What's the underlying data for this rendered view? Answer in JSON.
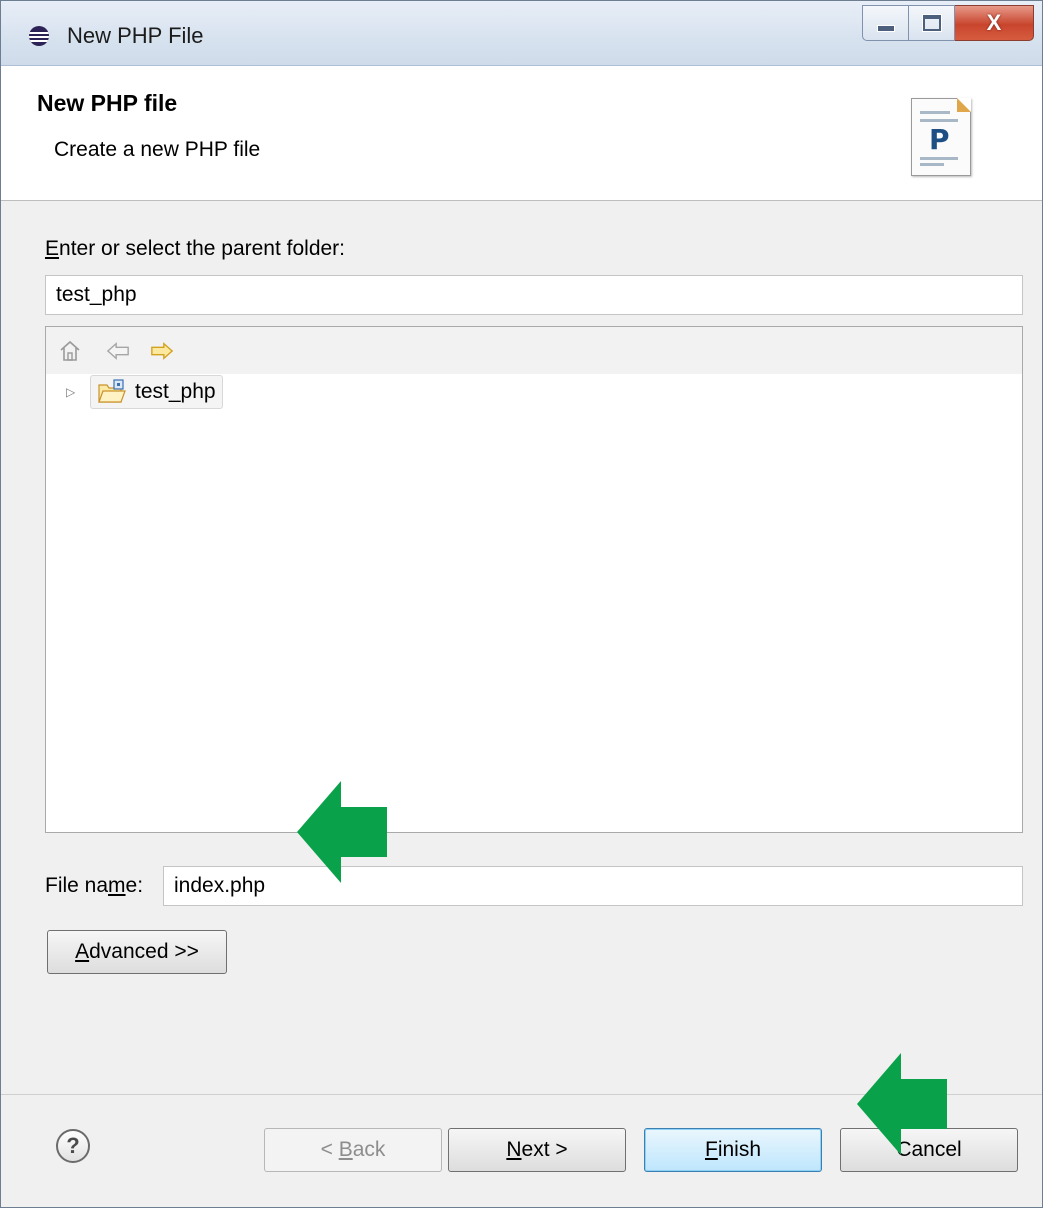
{
  "window": {
    "title": "New PHP File"
  },
  "header": {
    "title": "New PHP file",
    "description": "Create a new PHP file"
  },
  "parent_folder": {
    "label_mnemonic": "E",
    "label_rest": "nter or select the parent folder:",
    "value": "test_php"
  },
  "tree": {
    "items": [
      {
        "label": "test_php",
        "expanded": false
      }
    ]
  },
  "file_name": {
    "label_pre": "File na",
    "label_mnemonic": "m",
    "label_post": "e:",
    "value": "index.php"
  },
  "buttons": {
    "advanced": {
      "mnemonic": "A",
      "rest": "dvanced >>"
    },
    "back": {
      "pre": "< ",
      "mnemonic": "B",
      "rest": "ack"
    },
    "next": {
      "mnemonic": "N",
      "rest": "ext >"
    },
    "finish": {
      "mnemonic": "F",
      "rest": "inish"
    },
    "cancel": {
      "label": "Cancel"
    }
  },
  "help": {
    "glyph": "?"
  },
  "icons": {
    "php_file": {
      "letter": "P"
    }
  },
  "colors": {
    "annotation_arrow": "#0aa14b",
    "close_button": "#c8452d"
  }
}
